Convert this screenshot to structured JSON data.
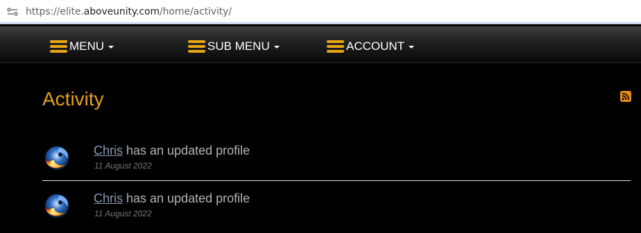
{
  "browser": {
    "url_scheme": "https://elite.",
    "url_host": "aboveunity.com",
    "url_path": "/home/activity/"
  },
  "nav": {
    "items": [
      {
        "label": "MENU"
      },
      {
        "label": "SUB MENU"
      },
      {
        "label": "ACCOUNT"
      }
    ],
    "icon_color": "#e8a615"
  },
  "page": {
    "title": "Activity",
    "title_color": "#e8a020"
  },
  "activity": [
    {
      "user": "Chris",
      "action": " has an updated profile",
      "date": "11 August 2022"
    },
    {
      "user": "Chris",
      "action": " has an updated profile",
      "date": "11 August 2022"
    }
  ],
  "icons": {
    "site_info": "site-settings-icon",
    "menu": "hamburger-icon",
    "rss": "rss-icon"
  }
}
